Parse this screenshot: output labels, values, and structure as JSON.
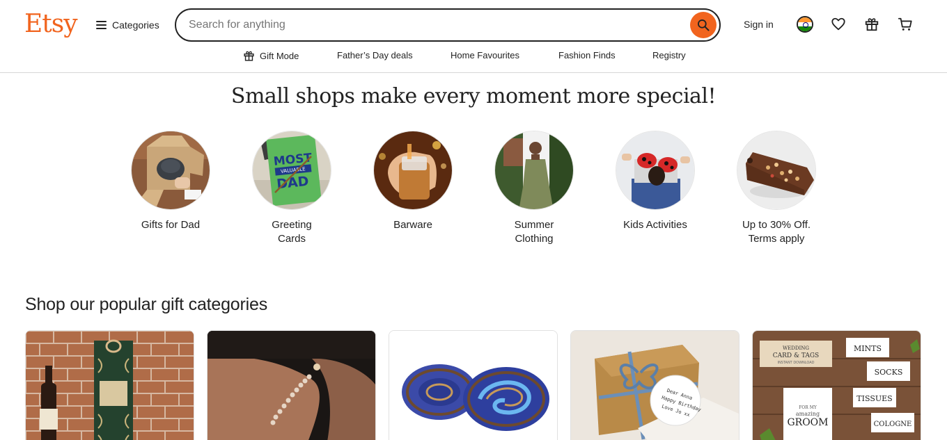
{
  "header": {
    "logo": "Etsy",
    "categories_label": "Categories",
    "search_placeholder": "Search for anything",
    "signin_label": "Sign in"
  },
  "subnav": [
    {
      "label": "Gift Mode",
      "icon": "gift-icon"
    },
    {
      "label": "Father’s Day deals"
    },
    {
      "label": "Home Favourites"
    },
    {
      "label": "Fashion Finds"
    },
    {
      "label": "Registry"
    }
  ],
  "hero": {
    "title": "Small shops make every moment more special!",
    "items": [
      {
        "label": "Gifts for Dad"
      },
      {
        "label": "Greeting Cards"
      },
      {
        "label": "Barware"
      },
      {
        "label": "Summer Clothing"
      },
      {
        "label": "Kids Activities"
      },
      {
        "label": "Up to 30% Off. Terms apply"
      }
    ]
  },
  "popular": {
    "title": "Shop our popular gift categories"
  },
  "colors": {
    "brand": "#f1641e",
    "text": "#222222"
  }
}
